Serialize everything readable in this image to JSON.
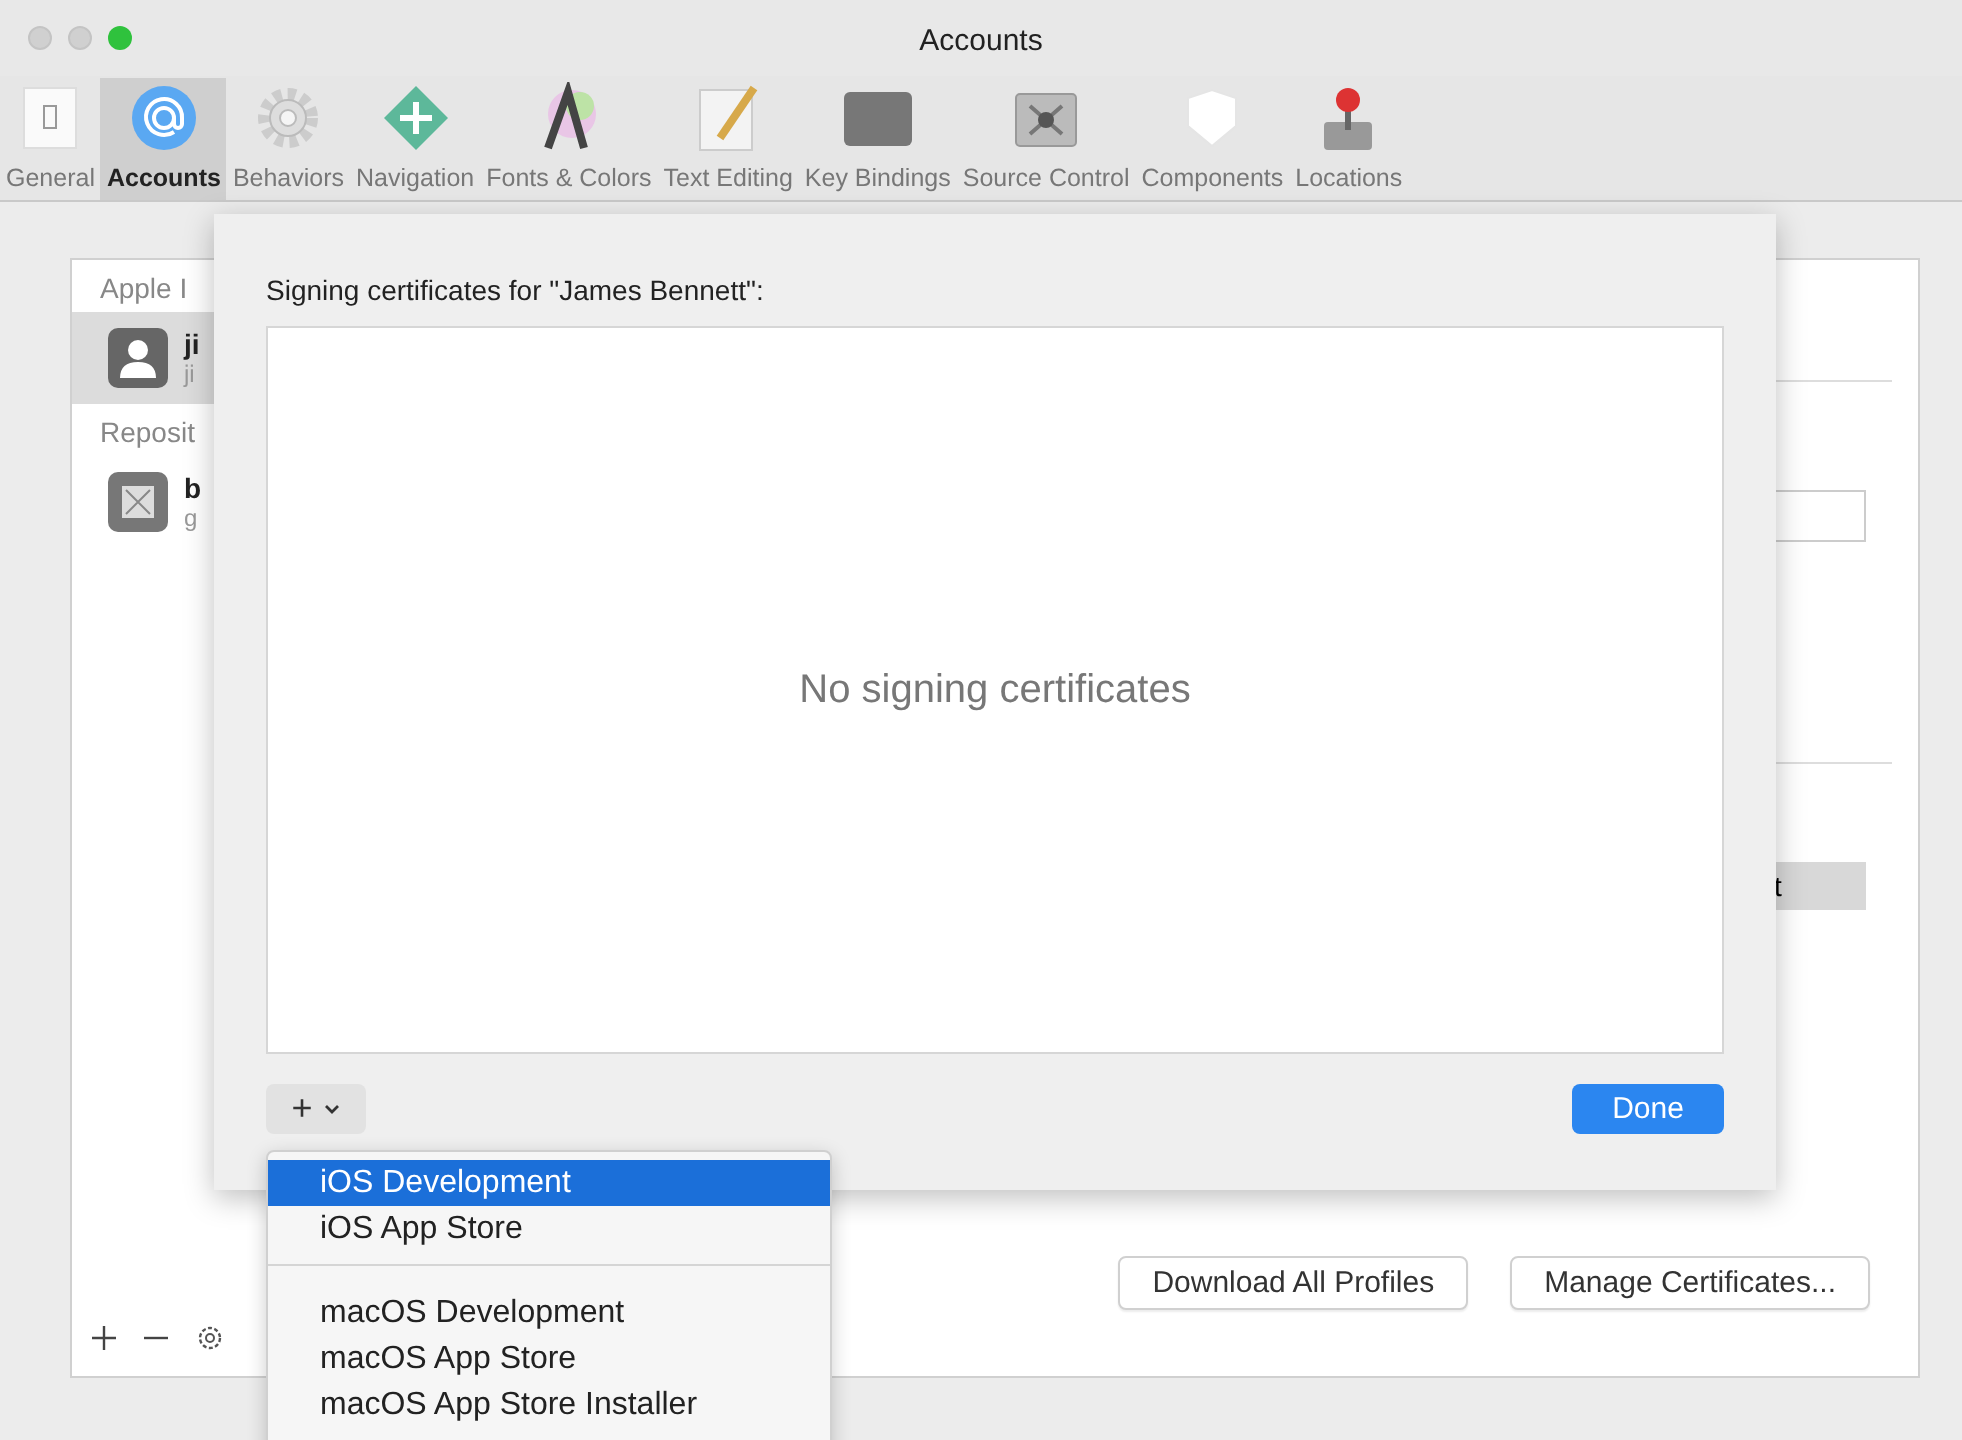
{
  "window": {
    "title": "Accounts"
  },
  "toolbar": {
    "items": [
      {
        "label": "General",
        "selected": false
      },
      {
        "label": "Accounts",
        "selected": true
      },
      {
        "label": "Behaviors",
        "selected": false
      },
      {
        "label": "Navigation",
        "selected": false
      },
      {
        "label": "Fonts & Colors",
        "selected": false
      },
      {
        "label": "Text Editing",
        "selected": false
      },
      {
        "label": "Key Bindings",
        "selected": false
      },
      {
        "label": "Source Control",
        "selected": false
      },
      {
        "label": "Components",
        "selected": false
      },
      {
        "label": "Locations",
        "selected": false
      }
    ]
  },
  "accounts_list": {
    "sections": [
      {
        "header": "Apple I",
        "items": [
          {
            "kind": "person",
            "name": "ji",
            "detail": "ji",
            "selected": true
          }
        ]
      },
      {
        "header": "Reposit",
        "items": [
          {
            "kind": "repository",
            "name": "b",
            "detail": "g",
            "selected": false
          }
        ]
      }
    ]
  },
  "detail_panel": {
    "button": "t",
    "buttons": [
      "Download All Profiles",
      "Manage Certificates..."
    ]
  },
  "sheet": {
    "title": "Signing certificates for \"James Bennett\":",
    "empty_message": "No signing certificates",
    "add_button": "+",
    "done_button": "Done"
  },
  "add_menu": {
    "groups": [
      [
        {
          "label": "iOS Development",
          "selected": true
        },
        {
          "label": "iOS App Store",
          "selected": false
        }
      ],
      [
        {
          "label": "macOS Development",
          "selected": false
        },
        {
          "label": "macOS App Store",
          "selected": false
        },
        {
          "label": "macOS App Store Installer",
          "selected": false
        }
      ]
    ]
  }
}
